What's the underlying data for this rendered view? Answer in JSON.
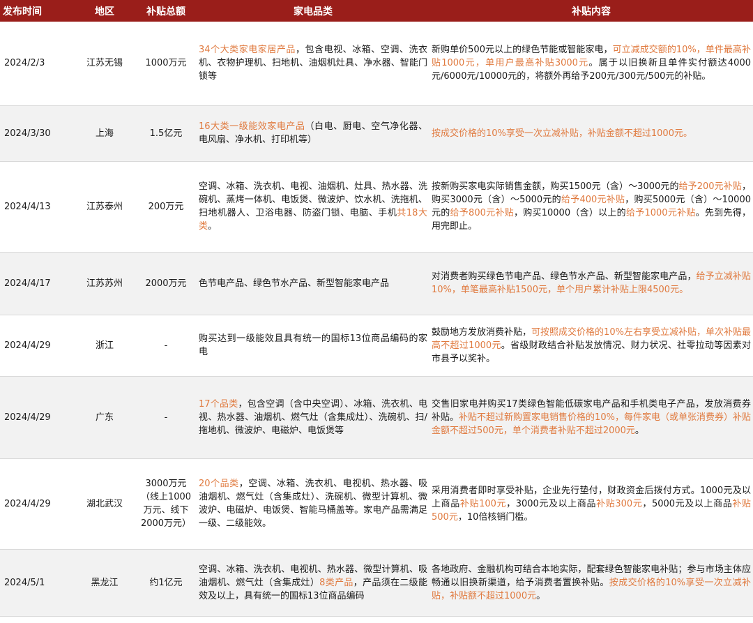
{
  "colors": {
    "header_bg": "#9a1e1a",
    "highlight": "#e07a3f",
    "stripe": "#f2f2f2"
  },
  "headers": [
    "发布时间",
    "地区",
    "补贴总额",
    "家电品类",
    "补贴内容"
  ],
  "rows": [
    {
      "date": "2024/2/3",
      "region": "江苏无锡",
      "amount": "1000万元",
      "category": [
        {
          "t": "34个大类家电家居产品",
          "h": true
        },
        {
          "t": "，包含电视、冰箱、空调、洗衣机、衣物护理机、扫地机、油烟机灶具、净水器、智能门锁等",
          "h": false
        }
      ],
      "content": [
        {
          "t": "新购单价500元以上的绿色节能或智能家电，",
          "h": false
        },
        {
          "t": "可立减成交额的10%，单件最高补贴1000元，单用户最高补贴3000元",
          "h": true
        },
        {
          "t": "。属于以旧换新且单件实付额达4000元/6000元/10000元的，将额外再给予200元/300元/500元的补贴。",
          "h": false
        }
      ]
    },
    {
      "date": "2024/3/30",
      "region": "上海",
      "amount": "1.5亿元",
      "category": [
        {
          "t": "16大类一级能效家电产品",
          "h": true
        },
        {
          "t": "（白电、厨电、空气净化器、电风扇、净水机、打印机等）",
          "h": false
        }
      ],
      "content": [
        {
          "t": "按成交价格的10%享受一次立减补贴，补贴金额不超过1000元。",
          "h": true
        }
      ]
    },
    {
      "date": "2024/4/13",
      "region": "江苏泰州",
      "amount": "200万元",
      "category": [
        {
          "t": "空调、冰箱、洗衣机、电视、油烟机、灶具、热水器、洗碗机、蒸烤一体机、电饭煲、微波炉、饮水机、洗拖机、扫地机器人、卫浴电器、防盗门锁、电脑、手机",
          "h": false
        },
        {
          "t": "共18大类",
          "h": true
        },
        {
          "t": "。",
          "h": false
        }
      ],
      "content": [
        {
          "t": "按新购买家电实际销售金额，购买1500元（含）～3000元的",
          "h": false
        },
        {
          "t": "给予200元补贴",
          "h": true
        },
        {
          "t": "，购买3000元（含）～5000元的",
          "h": false
        },
        {
          "t": "给予400元补贴",
          "h": true
        },
        {
          "t": "，购买5000元（含）～10000元的",
          "h": false
        },
        {
          "t": "给予800元补贴",
          "h": true
        },
        {
          "t": "，购买10000（含）以上的",
          "h": false
        },
        {
          "t": "给予1000元补贴",
          "h": true
        },
        {
          "t": "。先到先得，用完即止。",
          "h": false
        }
      ]
    },
    {
      "date": "2024/4/17",
      "region": "江苏苏州",
      "amount": "2000万元",
      "category": [
        {
          "t": "色节电产品、绿色节水产品、新型智能家电产品",
          "h": false
        }
      ],
      "content": [
        {
          "t": "对消费者购买绿色节电产品、绿色节水产品、新型智能家电产品，",
          "h": false
        },
        {
          "t": "给予立减补贴10%，单笔最高补贴1500元，单个用户累计补贴上限4500元。",
          "h": true
        }
      ]
    },
    {
      "date": "2024/4/29",
      "region": "浙江",
      "amount": "-",
      "category": [
        {
          "t": "购买达到一级能效且具有统一的国标13位商品编码的家电",
          "h": false
        }
      ],
      "content": [
        {
          "t": "鼓励地方发放消费补贴，",
          "h": false
        },
        {
          "t": "可按照成交价格的10%左右享受立减补贴，单次补贴最高不超过1000元",
          "h": true
        },
        {
          "t": "。省级财政结合补贴发放情况、财力状况、社零拉动等因素对市县予以奖补。",
          "h": false
        }
      ]
    },
    {
      "date": "2024/4/29",
      "region": "广东",
      "amount": "-",
      "category": [
        {
          "t": "17个品类",
          "h": true
        },
        {
          "t": "，包含空调（含中央空调）、冰箱、洗衣机、电视、热水器、油烟机、燃气灶（含集成灶）、洗碗机、扫/拖地机、微波炉、电磁炉、电饭煲等",
          "h": false
        }
      ],
      "content": [
        {
          "t": "交售旧家电并购买17类绿色智能低碳家电产品和手机类电子产品，发放消费券补贴。",
          "h": false
        },
        {
          "t": "补贴不超过新购置家电销售价格的10%，每件家电（或单张消费券）补贴金额不超过500元，单个消费者补贴不超过2000元",
          "h": true
        },
        {
          "t": "。",
          "h": false
        }
      ]
    },
    {
      "date": "2024/4/29",
      "region": "湖北武汉",
      "amount": "3000万元（线上1000万元、线下2000万元）",
      "category": [
        {
          "t": "20个品类",
          "h": true
        },
        {
          "t": "，空调、冰箱、洗衣机、电视机、热水器、吸油烟机、燃气灶（含集成灶）、洗碗机、微型计算机、微波炉、电磁炉、电饭煲、智能马桶盖等。家电产品需满足一级、二级能效。",
          "h": false
        }
      ],
      "content": [
        {
          "t": "采用消费者即时享受补贴，企业先行垫付，财政资金后拨付方式。1000元及以上商品",
          "h": false
        },
        {
          "t": "补贴100元",
          "h": true
        },
        {
          "t": "，3000元及以上商品",
          "h": false
        },
        {
          "t": "补贴300元",
          "h": true
        },
        {
          "t": "，5000元及以上商品",
          "h": false
        },
        {
          "t": "补贴500元",
          "h": true
        },
        {
          "t": "，10倍核销门槛。",
          "h": false
        }
      ]
    },
    {
      "date": "2024/5/1",
      "region": "黑龙江",
      "amount": "约1亿元",
      "category": [
        {
          "t": "空调、冰箱、洗衣机、电视机、热水器、微型计算机、吸油烟机、燃气灶（含集成灶）",
          "h": false
        },
        {
          "t": "8类产品",
          "h": true
        },
        {
          "t": "，产品须在二级能效及以上，具有统一的国标13位商品编码",
          "h": false
        }
      ],
      "content": [
        {
          "t": "各地政府、金融机构可结合本地实际，配套绿色智能家电补贴；参与市场主体应畅通以旧换新渠道，给予消费者置换补贴。",
          "h": false
        },
        {
          "t": "按成交价格的10%享受一次立减补贴，补贴额不超过1000元",
          "h": true
        },
        {
          "t": "。",
          "h": false
        }
      ]
    }
  ]
}
